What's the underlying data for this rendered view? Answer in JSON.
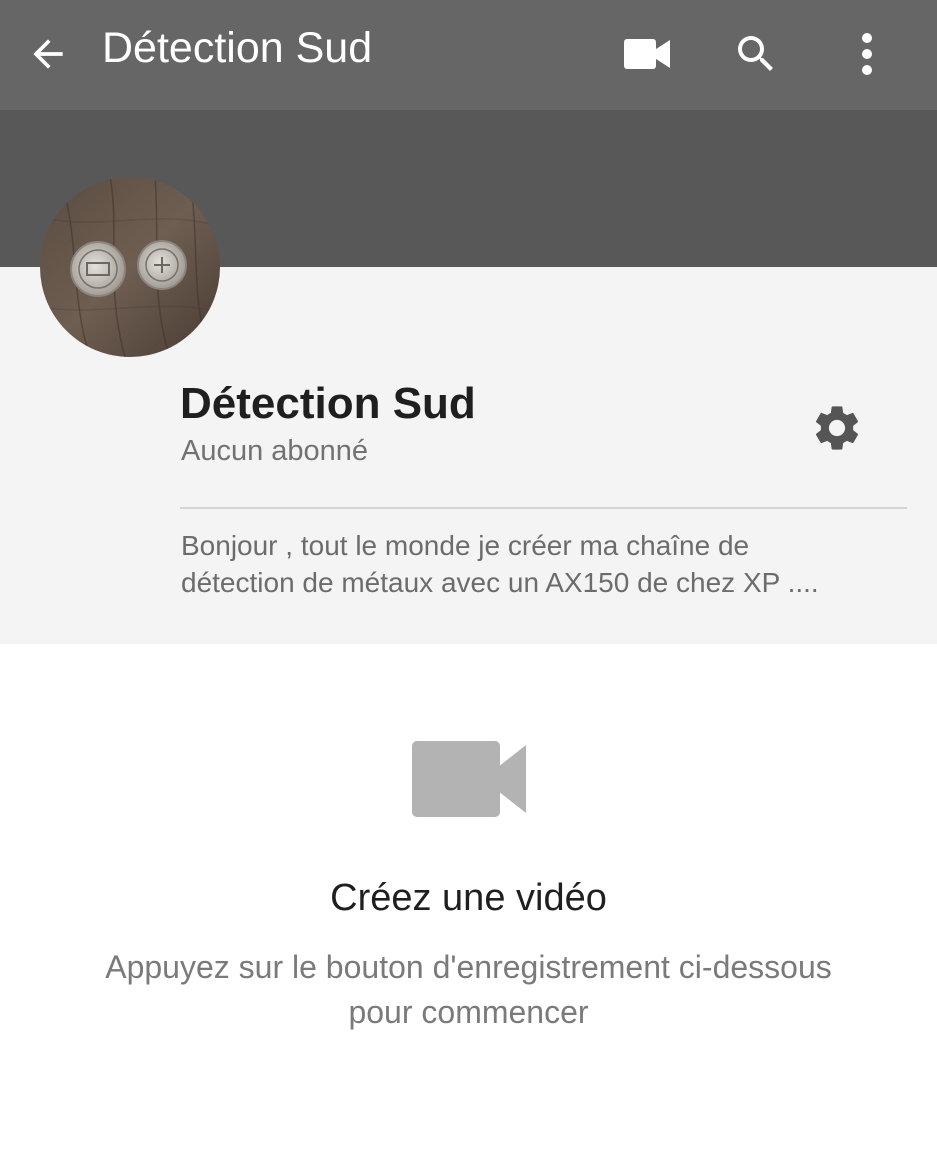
{
  "appbar": {
    "title": "Détection Sud",
    "back_icon": "arrow-back-icon",
    "actions": [
      "video-camera-icon",
      "search-icon",
      "more-vert-icon"
    ]
  },
  "channel": {
    "name": "Détection Sud",
    "subscribers": "Aucun abonné",
    "description_line1": "Bonjour , tout le monde je créer ma chaîne de",
    "description_line2": "détection de métaux avec un AX150 de chez XP ....",
    "settings_icon": "gear-icon"
  },
  "empty_state": {
    "icon": "video-camera-icon",
    "title": "Créez une vidéo",
    "subtitle_line1": "Appuyez sur le bouton d'enregistrement ci-dessous",
    "subtitle_line2": "pour commencer"
  },
  "colors": {
    "appbar": "#666666",
    "banner": "#585858",
    "panel": "#f4f4f4"
  }
}
